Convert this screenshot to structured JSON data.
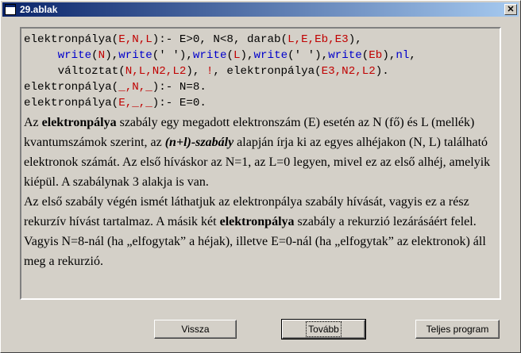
{
  "window": {
    "title": "29.ablak",
    "close_glyph": "✕"
  },
  "code": {
    "line1": {
      "p1": "elektronpálya(",
      "p2": "E,N,L",
      "p3": "):- E>0, N<8, darab(",
      "p4": "L,E,Eb,E3",
      "p5": "),",
      "color_kw": "#000000"
    },
    "line2": {
      "w1": "write",
      "w1a": "(",
      "w1b": "N",
      "w1c": "),",
      "w2": "write",
      "w2a": "(' '),",
      "w3": "write",
      "w3a": "(",
      "w3b": "L",
      "w3c": "),",
      "w4": "write",
      "w4a": "(' '),",
      "w5": "write",
      "w5a": "(",
      "w5b": "Eb",
      "w5c": "),",
      "w6": "nl",
      "w6a": ","
    },
    "line3": {
      "p1": "változtat(",
      "p2": "N,L,N2,L2",
      "p3": "), ",
      "p4": "!",
      "p5": ", elektronpálya(",
      "p6": "E3,N2,L2",
      "p7": ")."
    },
    "line4": {
      "p1": "elektronpálya(",
      "p2": "_,N,_",
      "p3": "):- N=8."
    },
    "line5": {
      "p1": "elektronpálya(",
      "p2": "E,_,_",
      "p3": "):- E=0."
    },
    "colors": {
      "variable": "#c00000",
      "builtin": "#0000cc",
      "text": "#000000"
    }
  },
  "prose": {
    "para1": {
      "t1": "Az ",
      "b1": "elektronpálya",
      "t2": " szabály egy megadott elektronszám (E) esetén az N (fő) és L (mellék) kvantumszámok szerint, az ",
      "bi1": "(n+l)-szabály",
      "t3": " alapján írja ki az egyes alhéjakon (N, L) található elektronok számát. Az első híváskor az N=1, az L=0 legyen, mivel ez az első alhéj, amelyik kiépül. A szabálynak 3 alakja is van."
    },
    "para2": {
      "t1": "Az első szabály végén ismét láthatjuk az elektronpálya szabály hívását, vagyis ez a rész rekurzív hívást tartalmaz. A másik két ",
      "b1": "elektronpálya",
      "t2": " szabály a rekurzió lezárásáért felel. Vagyis N=8-nál (ha „elfogytak” a héjak), illetve E=0-nál (ha „elfogytak” az elektronok) áll meg a rekurzió."
    }
  },
  "buttons": {
    "back": "Vissza",
    "next": "Tovább",
    "full": "Teljes program"
  }
}
